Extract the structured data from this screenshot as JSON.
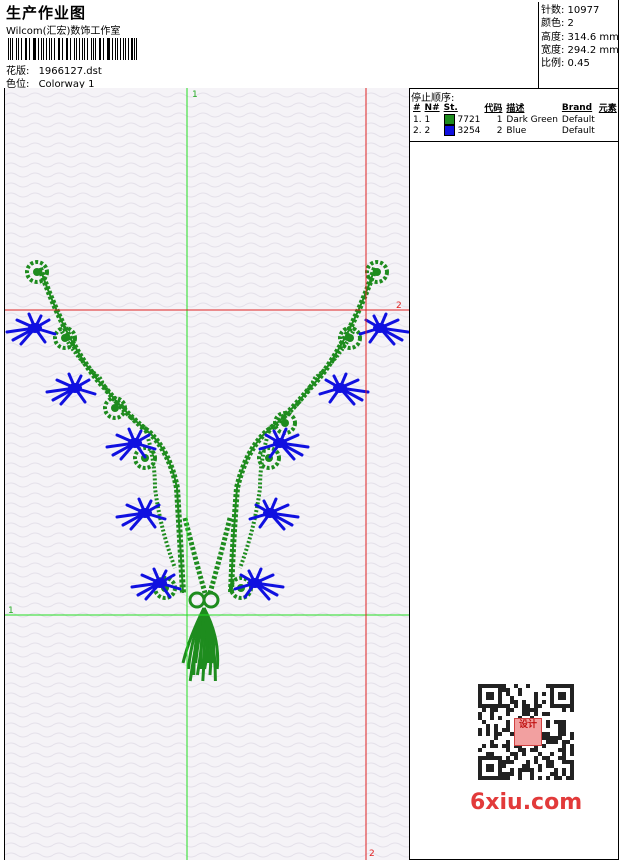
{
  "header": {
    "title": "生产作业图",
    "subtitle": "Wilcom(汇宏)数饰工作室",
    "design_label": "花版:",
    "design_value": "1966127.dst",
    "color_label": "色位:",
    "color_value": "Colorway 1"
  },
  "stats": {
    "stitches": "针数: 10977",
    "colors": "颜色: 2",
    "height": "高度: 314.6 mm",
    "width": "宽度: 294.2 mm",
    "scale": "比例: 0.45"
  },
  "stop_sequence": {
    "title": "停止顺序:",
    "headers": [
      "#",
      "N#",
      "St.",
      "代码",
      "描述",
      "Brand",
      "元素"
    ],
    "rows": [
      {
        "idx": "1. 1",
        "code": "7721",
        "st": "1",
        "desc": "Dark Green",
        "brand": "Default",
        "color": "#1e8c1e"
      },
      {
        "idx": "2. 2",
        "code": "3254",
        "st": "2",
        "desc": "Blue",
        "brand": "Default",
        "color": "#1010e0"
      }
    ]
  },
  "guides": {
    "green_label_top": "1",
    "green_label_left": "1",
    "red_label_right": "2",
    "red_label_bottom": "2"
  },
  "colors": {
    "green": "#1e8c1e",
    "blue": "#1010e0",
    "guide_green": "#22dd22",
    "guide_red": "#e02020",
    "watermark": "#e23a3a"
  },
  "watermark": "6xiu.com",
  "seal": "设计"
}
